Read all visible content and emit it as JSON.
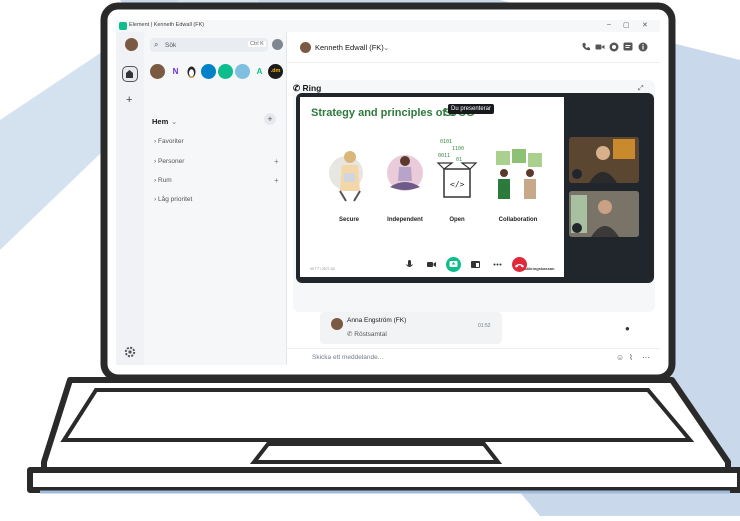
{
  "window": {
    "title": "Element | Kenneth Edwall (FK)",
    "minimize": "–",
    "maximize": "▢",
    "close": "✕"
  },
  "spaces": {
    "plus": "+",
    "settings_icon": "gear-icon"
  },
  "room_list": {
    "search_placeholder": "Sök",
    "search_shortcut": "Ctrl K",
    "favorites": [
      "N",
      "A",
      ".dm"
    ],
    "group_title": "Hem",
    "group_plus": "+",
    "sections": [
      {
        "label": "Favoriter",
        "add": ""
      },
      {
        "label": "Personer",
        "add": "+"
      },
      {
        "label": "Rum",
        "add": "+"
      },
      {
        "label": "Låg prioritet",
        "add": ""
      }
    ]
  },
  "room": {
    "name": "Kenneth Edwall (FK)",
    "name_chevron": "⌄"
  },
  "call": {
    "label": "Ring",
    "tooltip": "Du presenterar",
    "slide": {
      "title": "Strategy and principles of S",
      "title_tail": "SFCG",
      "items": [
        "Secure",
        "Independent",
        "Open",
        "Collaboration"
      ],
      "footer_left": "00 TT / 2077-02",
      "footer_right": "Försäkringskassan"
    }
  },
  "timeline": {
    "author": "Anna Engström (FK)",
    "time": "01:52",
    "body": "Röstsamtal"
  },
  "composer": {
    "placeholder": "Skicka ett meddelande..."
  },
  "colors": {
    "accent": "#0dbd8b",
    "hangup": "#e0283b",
    "slide_title": "#2d7a3d",
    "backdrop": "#c7d7ea"
  }
}
